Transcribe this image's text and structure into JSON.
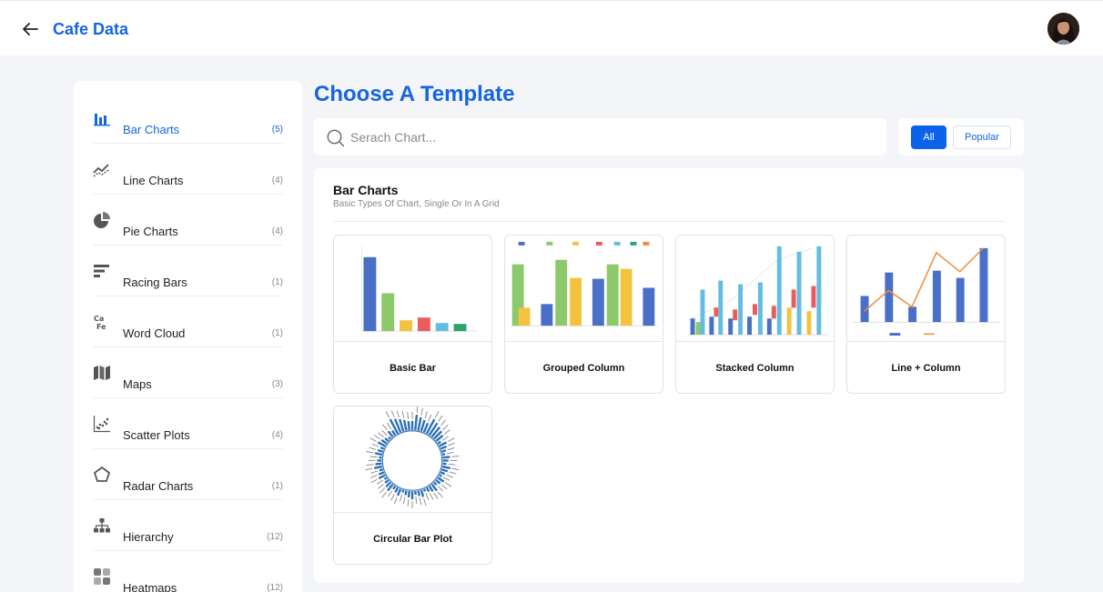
{
  "header": {
    "title": "Cafe Data"
  },
  "sidebar": {
    "items": [
      {
        "label": "Bar Charts",
        "count": "(5)",
        "icon": "bar-chart-icon"
      },
      {
        "label": "Line Charts",
        "count": "(4)",
        "icon": "line-chart-icon"
      },
      {
        "label": "Pie Charts",
        "count": "(4)",
        "icon": "pie-chart-icon"
      },
      {
        "label": "Racing Bars",
        "count": "(1)",
        "icon": "racing-bars-icon"
      },
      {
        "label": "Word Cloud",
        "count": "(1)",
        "icon": "word-cloud-icon"
      },
      {
        "label": "Maps",
        "count": "(3)",
        "icon": "map-icon"
      },
      {
        "label": "Scatter Plots",
        "count": "(4)",
        "icon": "scatter-plot-icon"
      },
      {
        "label": "Radar Charts",
        "count": "(1)",
        "icon": "radar-chart-icon"
      },
      {
        "label": "Hierarchy",
        "count": "(12)",
        "icon": "hierarchy-icon"
      },
      {
        "label": "Heatmaps",
        "count": "(12)",
        "icon": "heatmap-icon"
      }
    ],
    "active_index": 0
  },
  "main": {
    "heading": "Choose A Template",
    "search": {
      "placeholder": "Serach Chart...",
      "value": ""
    },
    "filters": {
      "all_label": "All",
      "popular_label": "Popular"
    },
    "section": {
      "title": "Bar Charts",
      "subtitle": "Basic Types Of Chart, Single Or In A Grid"
    },
    "templates": [
      {
        "label": "Basic Bar"
      },
      {
        "label": "Grouped Column"
      },
      {
        "label": "Stacked Column"
      },
      {
        "label": "Line + Column"
      },
      {
        "label": "Circular Bar Plot"
      }
    ]
  },
  "colors": {
    "accent": "#1565e0",
    "button_primary": "#0b63ea",
    "background": "#f3f5f9"
  }
}
